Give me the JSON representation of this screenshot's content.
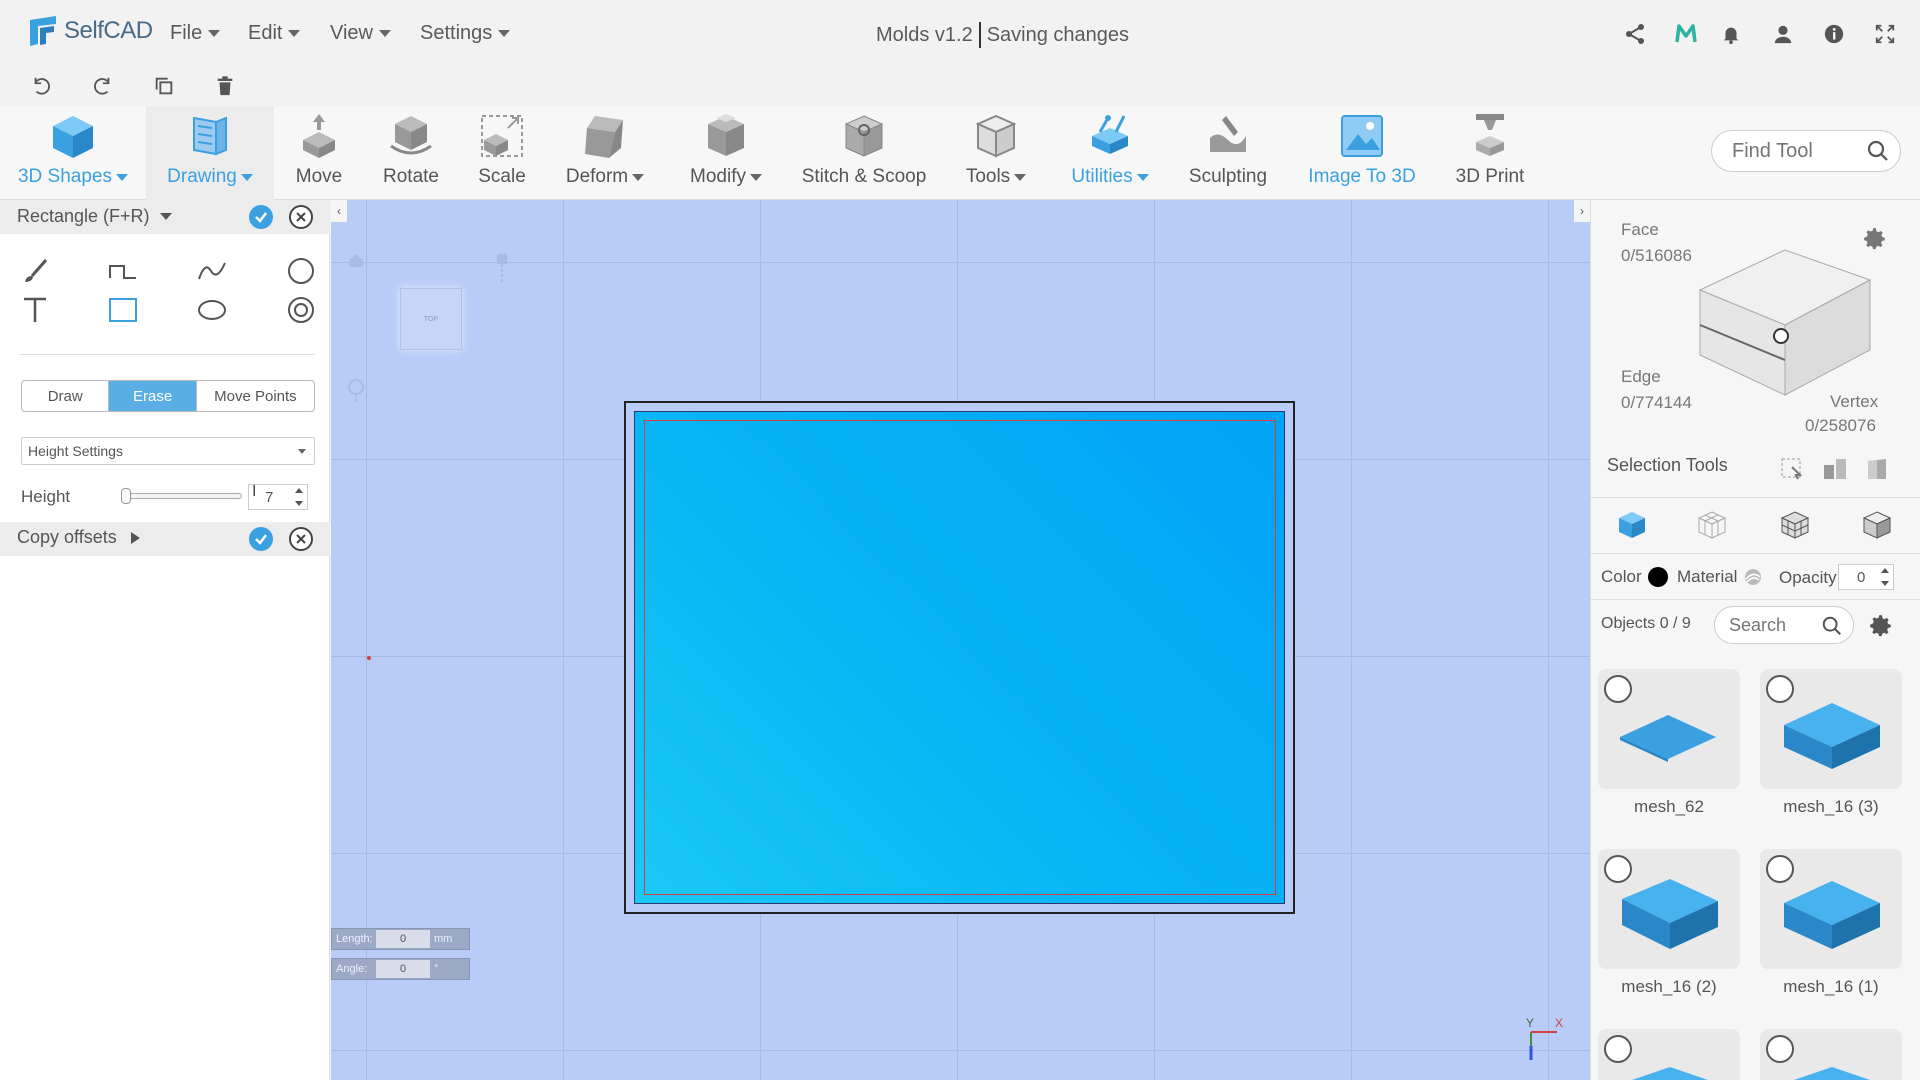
{
  "app": {
    "brand": "SelfCAD",
    "menu": [
      "File",
      "Edit",
      "View",
      "Settings"
    ],
    "project_name": "Molds v1.2",
    "save_status": "Saving changes"
  },
  "toolbar": {
    "tools": [
      {
        "label": "3D Shapes",
        "has_caret": true,
        "accent": true
      },
      {
        "label": "Drawing",
        "has_caret": true,
        "accent": true
      },
      {
        "label": "Move"
      },
      {
        "label": "Rotate"
      },
      {
        "label": "Scale"
      },
      {
        "label": "Deform",
        "has_caret": true
      },
      {
        "label": "Modify",
        "has_caret": true
      },
      {
        "label": "Stitch & Scoop"
      },
      {
        "label": "Tools",
        "has_caret": true
      },
      {
        "label": "Utilities",
        "has_caret": true,
        "accent": true
      },
      {
        "label": "Sculpting"
      },
      {
        "label": "Image To 3D",
        "accent": true
      },
      {
        "label": "3D Print"
      }
    ],
    "find_placeholder": "Find Tool"
  },
  "left_panel": {
    "title": "Rectangle (F+R)",
    "modes": [
      "Draw",
      "Erase",
      "Move Points"
    ],
    "active_mode": "Erase",
    "height_settings": "Height Settings",
    "height_label": "Height",
    "height_value": "7",
    "copy_offsets": "Copy offsets"
  },
  "viewport": {
    "navcube_label": "TOP",
    "length_label": "Length:",
    "length_value": "0",
    "length_unit": "mm",
    "angle_label": "Angle:",
    "angle_value": "0",
    "angle_unit": "°",
    "axis_x": "X",
    "axis_y": "Y"
  },
  "right_panel": {
    "face_label": "Face",
    "face_count": "0/516086",
    "edge_label": "Edge",
    "edge_count": "0/774144",
    "vertex_label": "Vertex",
    "vertex_count": "0/258076",
    "selection_tools": "Selection Tools",
    "color_label": "Color",
    "material_label": "Material",
    "opacity_label": "Opacity",
    "opacity_value": "0",
    "objects_count": "Objects 0 / 9",
    "search_placeholder": "Search",
    "objects": [
      {
        "name": "mesh_62"
      },
      {
        "name": "mesh_16 (3)"
      },
      {
        "name": "mesh_16 (2)"
      },
      {
        "name": "mesh_16 (1)"
      }
    ]
  },
  "colors": {
    "accent": "#3aa0e0",
    "viewport_bg": "#b9ccf7",
    "shape_fill": "#00b0f4",
    "outline_red": "#d14040"
  }
}
